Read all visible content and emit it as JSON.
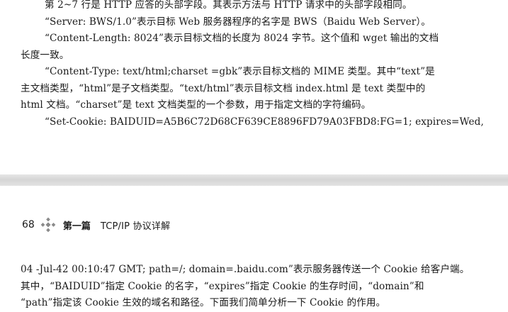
{
  "page_top": {
    "lines": [
      "第 2~7 行是 HTTP 应答的头部字段。其表示方法与 HTTP 请求中的头部字段相同。",
      "“Server: BWS/1.0”表示目标 Web 服务器程序的名字是 BWS（Baidu Web Server）。",
      "“Content-Length: 8024”表示目标文档的长度为 8024 字节。这个值和 wget 输出的文档",
      "长度一致。",
      "“Content-Type: text/html;charset =gbk”表示目标文档的 MIME 类型。其中“text”是",
      "主文档类型，“html”是子文档类型。“text/html”表示目标文档 index.html 是 text 类型中的",
      "html 文档。“charset”是 text 文档类型的一个参数，用于指定文档的字符编码。",
      "“Set-Cookie: BAIDUID=A5B6C72D68CF639CE8896FD79A03FBD8:FG=1; expires=Wed,"
    ]
  },
  "page_bottom": {
    "header": {
      "page_number": "68",
      "part": "第一篇",
      "chapter": "TCP/IP 协议详解"
    },
    "lines": [
      "04 -Jul-42 00:10:47 GMT; path=/; domain=.baidu.com”表示服务器传送一个 Cookie 给客户端。",
      "其中，“BAIDUID”指定 Cookie 的名字，“expires”指定 Cookie 的生存时间，“domain”和",
      "“path”指定该 Cookie 生效的域名和路径。下面我们简单分析一下 Cookie 的作用。"
    ]
  }
}
